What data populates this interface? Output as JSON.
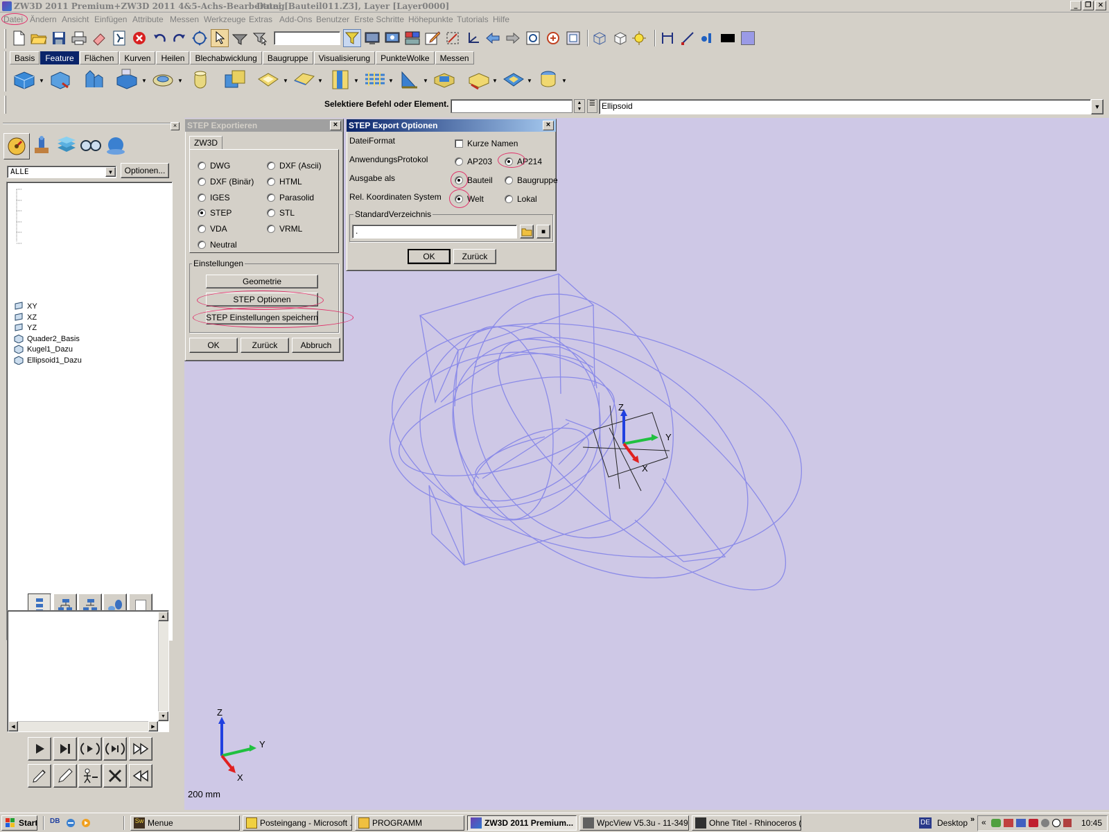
{
  "window": {
    "title": "ZW3D 2011 Premium+ZW3D 2011 4&5-Achs-Bearbeitung",
    "document": "Datei [Bauteil011.Z3], Layer [Layer0000]"
  },
  "menu": [
    "Datei",
    "Ändern",
    "Ansicht",
    "Einfügen",
    "Attribute",
    "Messen",
    "Werkzeuge",
    "Extras",
    "Add-Ons",
    "Benutzer",
    "Erste Schritte",
    "Höhepunkte",
    "Tutorials",
    "Hilfe"
  ],
  "ribbon_tabs": [
    "Basis",
    "Feature",
    "Flächen",
    "Kurven",
    "Heilen",
    "Blechabwicklung",
    "Baugruppe",
    "Visualisierung",
    "PunkteWolke",
    "Messen"
  ],
  "ribbon_active": "Feature",
  "command": {
    "label": "Selektiere Befehl oder Element.",
    "input_value": "",
    "history_value": "Ellipsoid"
  },
  "left_panel": {
    "filter": "ALLE",
    "options_button": "Optionen...",
    "tree": [
      "XY",
      "XZ",
      "YZ",
      "Quader2_Basis",
      "Kugel1_Dazu",
      "Ellipsoid1_Dazu"
    ]
  },
  "step_export": {
    "title": "STEP Exportieren",
    "tab": "ZW3D",
    "formats_left": [
      "DWG",
      "DXF (Binär)",
      "IGES",
      "STEP",
      "VDA",
      "Neutral"
    ],
    "formats_right": [
      "DXF (Ascii)",
      "HTML",
      "Parasolid",
      "STL",
      "VRML"
    ],
    "selected_format": "STEP",
    "settings_group": "Einstellungen",
    "btn_geometry": "Geometrie",
    "btn_step_options": "STEP Optionen",
    "btn_step_save": "STEP Einstellungen speichern",
    "btn_ok": "OK",
    "btn_back": "Zurück",
    "btn_cancel": "Abbruch"
  },
  "step_options": {
    "title": "STEP Export Optionen",
    "file_format_label": "DateiFormat",
    "short_names": "Kurze Namen",
    "protocol_label": "AnwendungsProtokol",
    "protocol_options": [
      "AP203",
      "AP214"
    ],
    "protocol_selected": "AP214",
    "output_label": "Ausgabe als",
    "output_options": [
      "Bauteil",
      "Baugruppe"
    ],
    "output_selected": "Bauteil",
    "coords_label": "Rel. Koordinaten System",
    "coords_options": [
      "Welt",
      "Lokal"
    ],
    "coords_selected": "Welt",
    "dir_group": "StandardVerzeichnis",
    "dir_value": ".",
    "btn_ok": "OK",
    "btn_back": "Zurück"
  },
  "viewport": {
    "scale_label": "200 mm",
    "axis_labels": [
      "Z",
      "Y",
      "X"
    ],
    "background": "#cec8e6",
    "wire_color": "#8a8ae8"
  },
  "taskbar": {
    "start": "Start",
    "items": [
      "Menue",
      "Posteingang - Microsoft ...",
      "PROGRAMM",
      "ZW3D 2011 Premium...",
      "WpcView V5.3u - 11-349....",
      "Ohne Titel - Rhinoceros (..."
    ],
    "active_item": "ZW3D 2011 Premium...",
    "lang": "DE",
    "desktop": "Desktop",
    "clock": "10:45"
  }
}
